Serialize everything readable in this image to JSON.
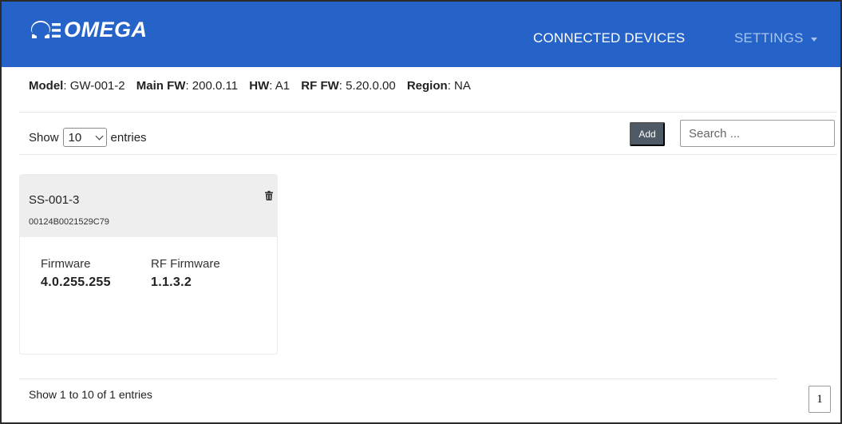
{
  "navbar": {
    "brand": "OMEGA",
    "links": [
      {
        "label": "CONNECTED DEVICES",
        "active": true
      },
      {
        "label": "SETTINGS",
        "active": false
      }
    ],
    "colors": {
      "background": "#2563c9",
      "active_link": "#ffffff",
      "inactive_link": "#a9c4ee"
    }
  },
  "gateway": {
    "model_label": "Model",
    "model_value": "GW-001-2",
    "main_fw_label": "Main FW",
    "main_fw_value": "200.0.11",
    "hw_label": "HW",
    "hw_value": "A1",
    "rf_fw_label": "RF FW",
    "rf_fw_value": "5.20.0.00",
    "region_label": "Region",
    "region_value": "NA"
  },
  "toolbar": {
    "show_label": "Show",
    "entries_value": "10",
    "entries_label": "entries",
    "add_label": "Add",
    "search_placeholder": "Search ..."
  },
  "devices": [
    {
      "name": "SS-001-3",
      "serial": "00124B0021529C79",
      "delete_icon": "trash-icon",
      "firmware_label": "Firmware",
      "firmware_value": "4.0.255.255",
      "rf_firmware_label": "RF Firmware",
      "rf_firmware_value": "1.1.3.2"
    }
  ],
  "footer": {
    "summary": "Show 1 to 10 of 1 entries",
    "current_page": "1"
  }
}
